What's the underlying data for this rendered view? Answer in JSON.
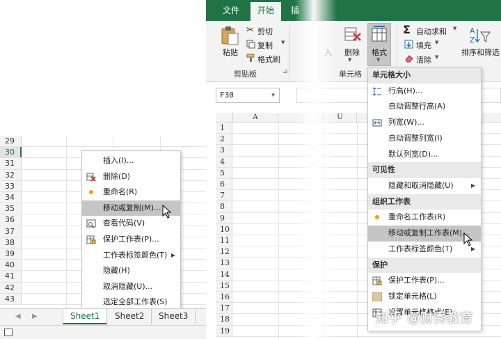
{
  "left": {
    "rows": [
      "29",
      "30",
      "31",
      "32",
      "33",
      "34",
      "35",
      "36",
      "37",
      "38",
      "39",
      "40",
      "41",
      "42",
      "43"
    ],
    "selected_row": "30",
    "context_menu": [
      {
        "label": "插入(I)...",
        "icon": "none"
      },
      {
        "label": "删除(D)",
        "icon": "delete-sheet-icon"
      },
      {
        "label": "重命名(R)",
        "icon": "rename-dot-icon"
      },
      {
        "label": "移动或复制(M)...",
        "icon": "none",
        "highlighted": true
      },
      {
        "label": "查看代码(V)",
        "icon": "view-code-icon"
      },
      {
        "label": "保护工作表(P)...",
        "icon": "protect-sheet-icon"
      },
      {
        "label": "工作表标签颜色(T)",
        "icon": "none",
        "submenu": true
      },
      {
        "label": "隐藏(H)",
        "icon": "none"
      },
      {
        "label": "取消隐藏(U)...",
        "icon": "none"
      },
      {
        "label": "选定全部工作表(S)",
        "icon": "none"
      }
    ],
    "sheets": [
      "Sheet1",
      "Sheet2",
      "Sheet3"
    ],
    "active_sheet": "Sheet1"
  },
  "right": {
    "tabs": [
      "文件",
      "开始",
      "插"
    ],
    "active_tab": "开始",
    "clipboard": {
      "paste": "粘贴",
      "cut": "剪切",
      "copy": "复制",
      "format_painter": "格式刷",
      "group_label": "剪贴板"
    },
    "cells": {
      "insert": "入",
      "delete": "删除",
      "format": "格式",
      "group_label": "单元格"
    },
    "editing": {
      "autosum": "自动求和",
      "fill": "填充",
      "clear": "清除",
      "sort_filter": "排序和筛选"
    },
    "name_box": "F30",
    "columns": [
      "A",
      "U"
    ],
    "rows": [
      "1",
      "2",
      "3",
      "4",
      "5",
      "6",
      "7",
      "8",
      "9",
      "10",
      "11",
      "12",
      "13",
      "14",
      "15",
      "16",
      "17",
      "18",
      "19"
    ],
    "format_menu": [
      {
        "type": "header",
        "label": "单元格大小"
      },
      {
        "type": "item",
        "label": "行高(H)...",
        "icon": "row-height-icon"
      },
      {
        "type": "item",
        "label": "自动调整行高(A)"
      },
      {
        "type": "item",
        "label": "列宽(W)...",
        "icon": "column-width-icon"
      },
      {
        "type": "item",
        "label": "自动调整列宽(I)"
      },
      {
        "type": "item",
        "label": "默认列宽(D)..."
      },
      {
        "type": "header",
        "label": "可见性"
      },
      {
        "type": "item",
        "label": "隐藏和取消隐藏(U)",
        "submenu": true
      },
      {
        "type": "header",
        "label": "组织工作表"
      },
      {
        "type": "item",
        "label": "重命名工作表(R)",
        "icon": "rename-dot-icon"
      },
      {
        "type": "item",
        "label": "移动或复制工作表(M)...",
        "highlighted": true
      },
      {
        "type": "item",
        "label": "工作表标签颜色(T)",
        "submenu": true
      },
      {
        "type": "header",
        "label": "保护"
      },
      {
        "type": "item",
        "label": "保护工作表(P)...",
        "icon": "protect-sheet-icon"
      },
      {
        "type": "item",
        "label": "锁定单元格(L)",
        "icon": "lock-cell-icon"
      },
      {
        "type": "item",
        "label": "设置单元格格式(E)...",
        "icon": "format-cells-icon"
      }
    ],
    "watermark": "知乎 @财秀教育"
  },
  "colors": {
    "excel_green": "#217346",
    "highlight": "#c5c5c5",
    "dot_orange": "#f29a1f"
  }
}
